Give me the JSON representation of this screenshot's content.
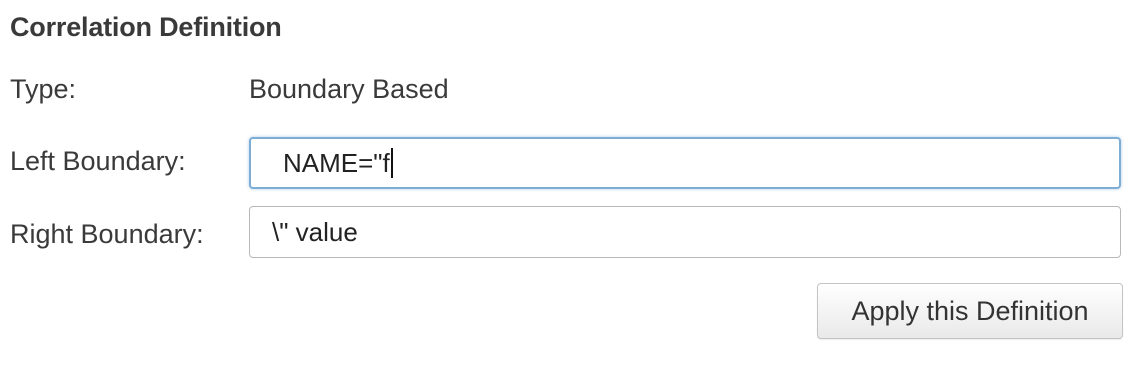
{
  "section": {
    "title": "Correlation Definition"
  },
  "type": {
    "label": "Type:",
    "value": "Boundary Based"
  },
  "left_boundary": {
    "label": "Left Boundary:",
    "value": "NAME=\"f"
  },
  "right_boundary": {
    "label": "Right Boundary:",
    "value": "\\\" value"
  },
  "apply_button": {
    "label": "Apply this Definition"
  },
  "colors": {
    "focus_border": "#7eaed6",
    "field_border": "#b9b9b9",
    "text": "#3a3a3a"
  }
}
